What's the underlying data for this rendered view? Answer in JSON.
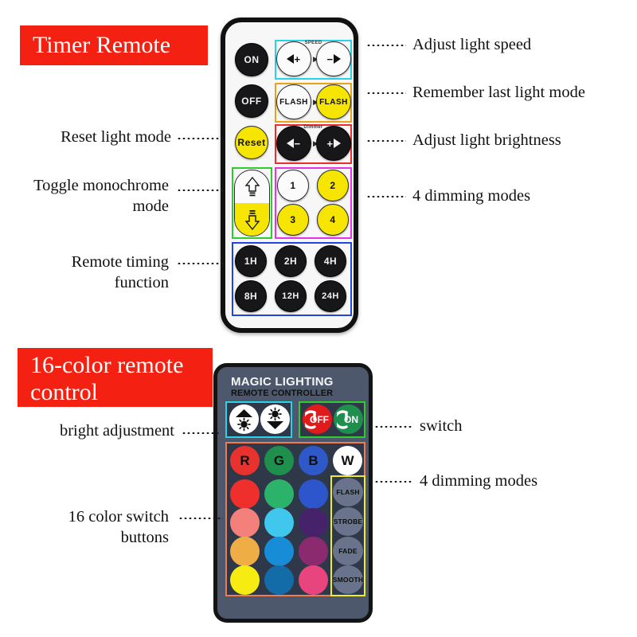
{
  "sections": [
    {
      "id": "timer",
      "banner": "Timer Remote"
    },
    {
      "id": "color",
      "banner": "16-color remote\ncontrol"
    }
  ],
  "callouts": {
    "timer_remote": [
      {
        "key": "speed",
        "text": "Adjust light speed",
        "side": "right"
      },
      {
        "key": "memory",
        "text": "Remember last light mode",
        "side": "right"
      },
      {
        "key": "brightness",
        "text": "Adjust light brightness",
        "side": "right"
      },
      {
        "key": "dimming",
        "text": "4 dimming modes",
        "side": "right"
      },
      {
        "key": "reset",
        "text": "Reset light mode",
        "side": "left"
      },
      {
        "key": "monochrome",
        "text": "Toggle monochrome\nmode",
        "side": "left"
      },
      {
        "key": "timing",
        "text": "Remote timing\nfunction",
        "side": "left"
      }
    ],
    "color_remote": [
      {
        "key": "switch",
        "text": "switch",
        "side": "right"
      },
      {
        "key": "dimming",
        "text": "4 dimming modes",
        "side": "right"
      },
      {
        "key": "bright",
        "text": "bright adjustment",
        "side": "left"
      },
      {
        "key": "colors",
        "text": "16 color switch\nbuttons",
        "side": "left"
      }
    ]
  },
  "timer_remote": {
    "power": [
      {
        "label": "ON",
        "style": "black"
      },
      {
        "label": "OFF",
        "style": "black"
      },
      {
        "label": "Reset",
        "style": "yellow"
      }
    ],
    "speed_group": {
      "caption": "SPEED",
      "outline_color": "#2ad2e8",
      "buttons": [
        {
          "label": "◀+",
          "style": "white"
        },
        {
          "label": "−▶",
          "style": "white"
        }
      ]
    },
    "flash_group": {
      "outline_color": "#e8a317",
      "buttons": [
        {
          "label": "FLASH",
          "style": "white"
        },
        {
          "label": "FLASH",
          "style": "yellow"
        }
      ]
    },
    "dimmer_group": {
      "caption": "Dimmer",
      "outline_color": "#ef2b2b",
      "buttons": [
        {
          "label": "◀−",
          "style": "black"
        },
        {
          "label": "+▶",
          "style": "black"
        }
      ]
    },
    "mono_group": {
      "outline_color": "#2ecc2e",
      "buttons": [
        {
          "label": "up-arrow-icon",
          "style": "white"
        },
        {
          "label": "down-arrow-icon",
          "style": "yellow"
        }
      ]
    },
    "mode_group": {
      "outline_color": "#e832e8",
      "buttons": [
        {
          "label": "1",
          "style": "white"
        },
        {
          "label": "2",
          "style": "yellow"
        },
        {
          "label": "3",
          "style": "yellow"
        },
        {
          "label": "4",
          "style": "yellow"
        }
      ]
    },
    "timer_group": {
      "outline_color": "#2244dd",
      "buttons": [
        {
          "label": "1H",
          "style": "black"
        },
        {
          "label": "2H",
          "style": "black"
        },
        {
          "label": "4H",
          "style": "black"
        },
        {
          "label": "8H",
          "style": "black"
        },
        {
          "label": "12H",
          "style": "black"
        },
        {
          "label": "24H",
          "style": "black"
        }
      ]
    }
  },
  "color_remote": {
    "brand_title": "MAGIC LIGHTING",
    "brand_subtitle": "REMOTE CONTROLLER",
    "brightness_group": {
      "outline_color": "#2ad2e8",
      "buttons": [
        {
          "label": "brightness-up-icon",
          "color": "#ffffff"
        },
        {
          "label": "brightness-down-icon",
          "color": "#ffffff"
        }
      ]
    },
    "power_group": {
      "outline_color": "#2ecc2e",
      "buttons": [
        {
          "label": "OFF",
          "color": "#e01b1b"
        },
        {
          "label": "ON",
          "color": "#1f8f4e"
        }
      ]
    },
    "color_group": {
      "outline_color": "#f07b50",
      "rows": [
        [
          {
            "label": "R",
            "color": "#e8322e"
          },
          {
            "label": "G",
            "color": "#1f8f4e"
          },
          {
            "label": "B",
            "color": "#2f58c8"
          },
          {
            "label": "W",
            "color": "#ffffff"
          }
        ],
        [
          {
            "label": "",
            "color": "#ef2f2c"
          },
          {
            "label": "",
            "color": "#2bb36b"
          },
          {
            "label": "",
            "color": "#2d56cc"
          }
        ],
        [
          {
            "label": "",
            "color": "#f4807b"
          },
          {
            "label": "",
            "color": "#3fc7ee"
          },
          {
            "label": "",
            "color": "#46226b"
          }
        ],
        [
          {
            "label": "",
            "color": "#efad46"
          },
          {
            "label": "",
            "color": "#168dd6"
          },
          {
            "label": "",
            "color": "#8c2a70"
          }
        ],
        [
          {
            "label": "",
            "color": "#f6ec11"
          },
          {
            "label": "",
            "color": "#136ba8"
          },
          {
            "label": "",
            "color": "#e8457f"
          }
        ]
      ]
    },
    "effect_group": {
      "outline_color": "#eded2e",
      "buttons": [
        "FLASH",
        "STROBE",
        "FADE",
        "SMOOTH"
      ]
    }
  },
  "colors": {
    "banner_bg": "#f42112",
    "banner_text": "#ffffff",
    "label_text": "#111111",
    "remote1_body": "#f7f7f7",
    "remote2_body": "#4d586d",
    "remote2_panel": "#2f3849"
  }
}
